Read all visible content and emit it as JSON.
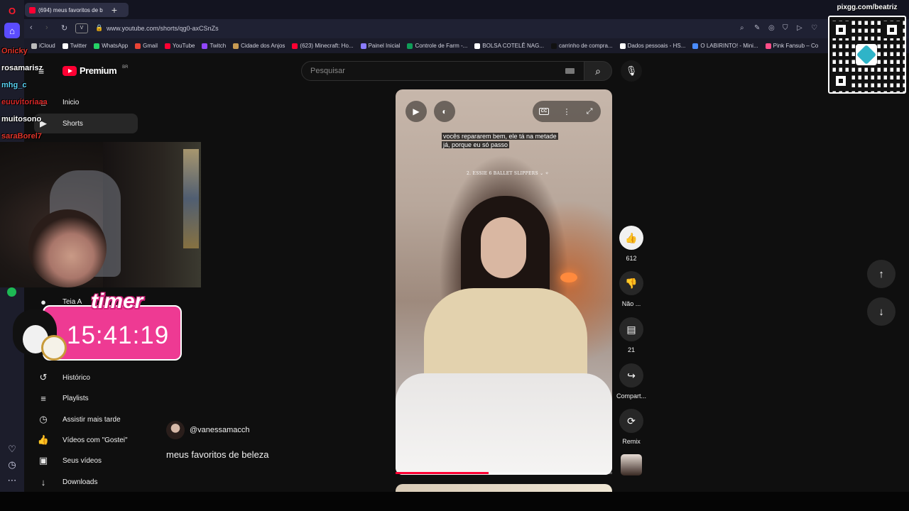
{
  "browser": {
    "tab_title": "(694) meus favoritos de b",
    "new_tab": "+",
    "url": "www.youtube.com/shorts/qg0-axCSnZs",
    "url_badge": "V",
    "bookmarks": [
      {
        "label": "iCloud",
        "color": "#bbbbbb"
      },
      {
        "label": "Twitter",
        "color": "#ffffff"
      },
      {
        "label": "WhatsApp",
        "color": "#25d366"
      },
      {
        "label": "Gmail",
        "color": "#ea4335"
      },
      {
        "label": "YouTube",
        "color": "#ff0033"
      },
      {
        "label": "Twitch",
        "color": "#9146ff"
      },
      {
        "label": "Cidade dos Anjos",
        "color": "#c79a52"
      },
      {
        "label": "(623) Minecraft: Ho...",
        "color": "#ff0033"
      },
      {
        "label": "Painel Inicial",
        "color": "#8a7cff"
      },
      {
        "label": "Controle de Farm -...",
        "color": "#0f9d58"
      },
      {
        "label": "BOLSA COTELÊ NAG...",
        "color": "#ffffff"
      },
      {
        "label": "carrinho de compra...",
        "color": "#111111"
      },
      {
        "label": "Dados pessoais - HS...",
        "color": "#ffffff"
      },
      {
        "label": "O LABIRINTO! - Mini...",
        "color": "#4a8cff"
      },
      {
        "label": "Pink Fansub – Co",
        "color": "#ff4d88"
      }
    ]
  },
  "youtube": {
    "logo_text": "Premium",
    "country": "BR",
    "search_placeholder": "Pesquisar",
    "sidebar": [
      {
        "label": "Inicio",
        "icon": "home-icon",
        "glyph": "⌂"
      },
      {
        "label": "Shorts",
        "icon": "shorts-icon",
        "glyph": "▶"
      },
      {
        "label": "Teia A",
        "icon": "subscription-icon",
        "glyph": "●"
      },
      {
        "label": "Histórico",
        "icon": "history-icon",
        "glyph": "↺"
      },
      {
        "label": "Playlists",
        "icon": "playlist-icon",
        "glyph": "≡"
      },
      {
        "label": "Assistir mais tarde",
        "icon": "clock-icon",
        "glyph": "◷"
      },
      {
        "label": "Vídeos com \"Gostei\"",
        "icon": "like-icon",
        "glyph": "👍"
      },
      {
        "label": "Seus vídeos",
        "icon": "your-videos-icon",
        "glyph": "▣"
      },
      {
        "label": "Downloads",
        "icon": "download-icon",
        "glyph": "↓"
      }
    ],
    "video": {
      "subtitle_line1": "vocês repararem bem, ele tá na metade",
      "subtitle_line2": "já, porque eu só passo",
      "overlay_text": "2. ESSIE 6 BALLET SLIPPERS ⌄ ✧",
      "progress": 0.43
    },
    "actions": {
      "likes": "612",
      "dislike": "Não ...",
      "comments": "21",
      "share": "Compart...",
      "remix": "Remix"
    },
    "channel": "@vanessamacch",
    "title": "meus favoritos de beleza"
  },
  "stream": {
    "chat_users": [
      {
        "name": "Onicky",
        "color": "#e0352b"
      },
      {
        "name": "rosamarisz",
        "color": "#ffffff"
      },
      {
        "name": "mhg_c",
        "color": "#5ad2f4"
      },
      {
        "name": "euuvitoriaaa",
        "color": "#d62828"
      },
      {
        "name": "muitosono",
        "color": "#ffffff"
      },
      {
        "name": "saraBorel7",
        "color": "#e0352b"
      }
    ],
    "timer_title": "timer",
    "timer_value": "15:41:19",
    "qr_label": "pixgg.com/beatriz"
  }
}
